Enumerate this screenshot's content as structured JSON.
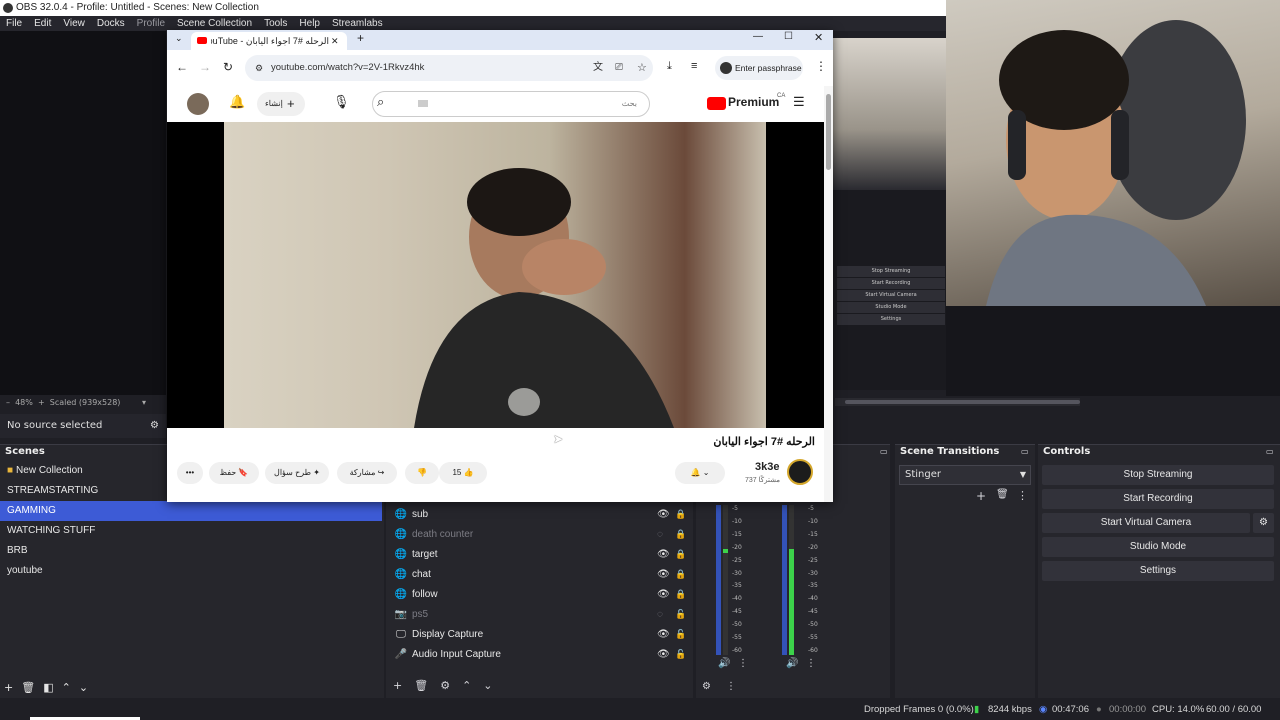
{
  "obs": {
    "title": "OBS 32.0.4 - Profile: Untitled - Scenes: New Collection",
    "menu": [
      "File",
      "Edit",
      "View",
      "Docks",
      "Profile",
      "Scene Collection",
      "Tools",
      "Help",
      "Streamlabs"
    ],
    "zoom": "48%",
    "scale": "Scaled (939x528)",
    "no_source": "No source selected",
    "scenes_title": "Scenes",
    "scenes": [
      "New Collection",
      "STREAMSTARTING",
      "GAMMING",
      "WATCHING STUFF",
      "BRB",
      "youtube"
    ],
    "selected_scene": "GAMMING",
    "sources": [
      {
        "name": "sub",
        "icon": "globe-icon",
        "visible": true
      },
      {
        "name": "death counter",
        "icon": "globe-icon",
        "visible": false
      },
      {
        "name": "target",
        "icon": "globe-icon",
        "visible": true
      },
      {
        "name": "chat",
        "icon": "globe-icon",
        "visible": true
      },
      {
        "name": "follow",
        "icon": "globe-icon",
        "visible": true
      },
      {
        "name": "ps5",
        "icon": "camera-icon",
        "visible": false
      },
      {
        "name": "Display Capture",
        "icon": "monitor-icon",
        "visible": true
      },
      {
        "name": "Audio Input Capture",
        "icon": "microphone-icon",
        "visible": true
      }
    ],
    "meter_ticks": [
      "-5",
      "-10",
      "-15",
      "-20",
      "-25",
      "-30",
      "-35",
      "-40",
      "-45",
      "-50",
      "-55",
      "-60"
    ],
    "transitions_title": "Scene Transitions",
    "transition": "Stinger",
    "controls_title": "Controls",
    "controls": [
      "Stop Streaming",
      "Start Recording",
      "Start Virtual Camera",
      "Studio Mode",
      "Settings"
    ],
    "status": {
      "dropped": "Dropped Frames 0 (0.0%)",
      "bitrate": "8244 kbps",
      "stream_time": "00:47:06",
      "rec_time": "00:00:00",
      "cpu": "CPU: 14.0%",
      "fps": "60.00 / 60.00 FPS"
    },
    "embed_controls": [
      "Stop Streaming",
      "Start Recording",
      "Start Virtual Camera",
      "Studio Mode",
      "Settings"
    ]
  },
  "browser": {
    "tab_title": "الرحله #7 اجواء اليابان - YouTube",
    "url": "youtube.com/watch?v=2V-1Rkvz4hk",
    "passphrase": "Enter passphrase",
    "create_label": "إنشاء",
    "search_placeholder": "بحث",
    "premium": "Premium",
    "premium_region": "CA",
    "video_title": "الرحله #7 اجواء اليابان",
    "channel": "3k3e",
    "subscribers": "737 مشتركًا",
    "likes": "15",
    "share": "مشاركة",
    "ask": "طرح سؤال",
    "save": "حفظ"
  },
  "colors": {
    "accent": "#3d5bd6",
    "yt_red": "#ff0000",
    "meter_green": "#3cd24a"
  }
}
